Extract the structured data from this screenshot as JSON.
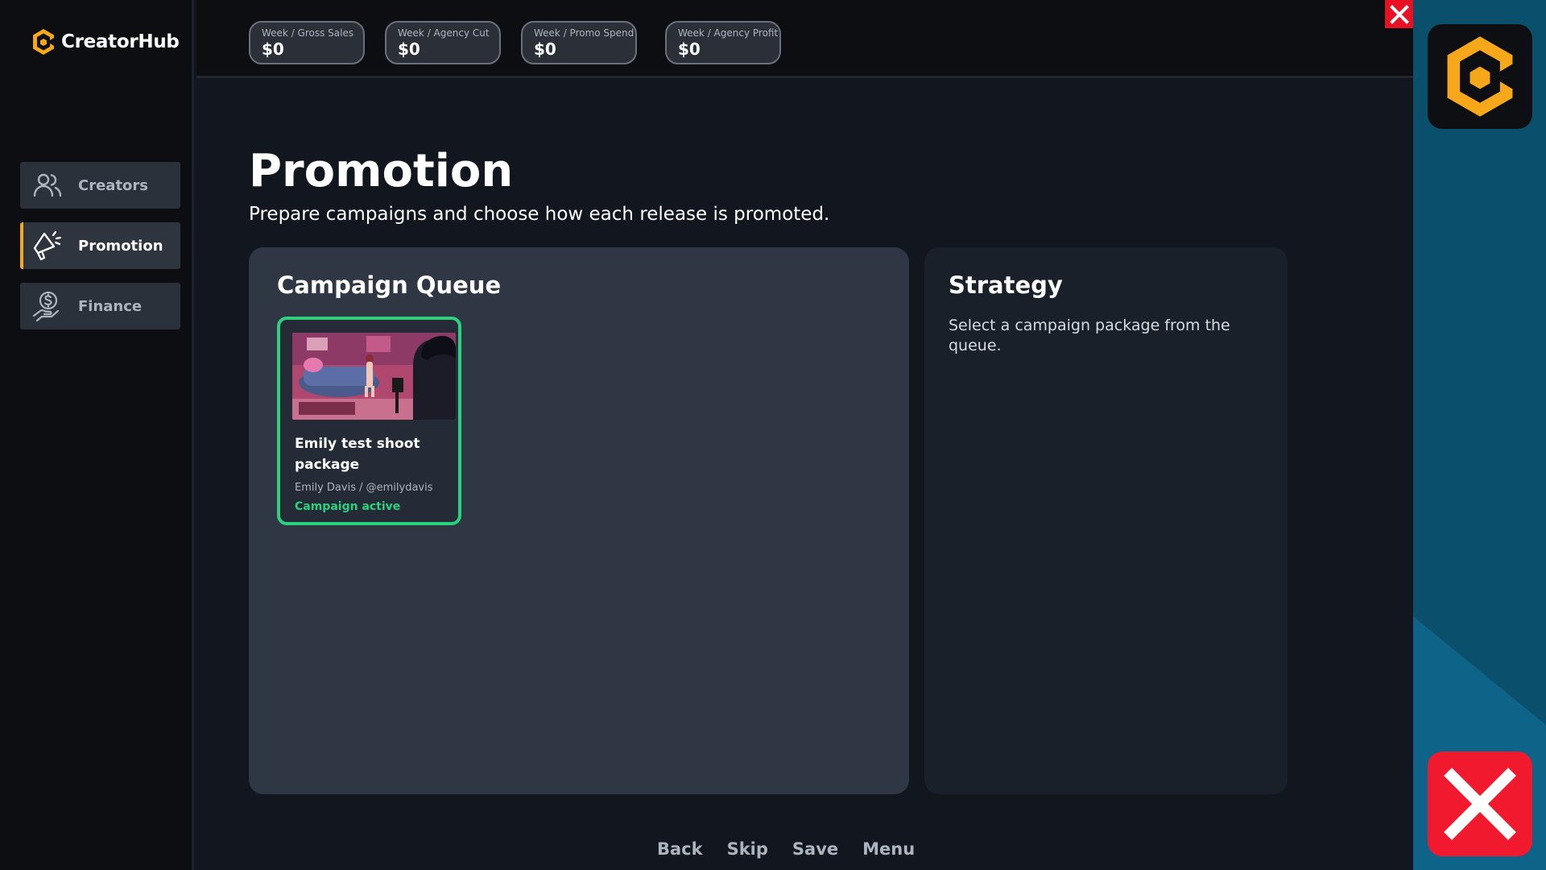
{
  "app": {
    "name": "CreatorHub"
  },
  "sidebar": {
    "items": [
      {
        "label": "Creators",
        "icon": "users-icon",
        "active": false
      },
      {
        "label": "Promotion",
        "icon": "megaphone-icon",
        "active": true
      },
      {
        "label": "Finance",
        "icon": "money-hand-icon",
        "active": false
      }
    ]
  },
  "stats": [
    {
      "label": "Week / Gross Sales",
      "value": "$0"
    },
    {
      "label": "Week / Agency Cut",
      "value": "$0"
    },
    {
      "label": "Week / Promo Spend",
      "value": "$0"
    },
    {
      "label": "Week / Agency Profit",
      "value": "$0"
    }
  ],
  "page": {
    "title": "Promotion",
    "subtitle": "Prepare campaigns and choose how each release is promoted."
  },
  "queue": {
    "title": "Campaign Queue",
    "cards": [
      {
        "title": "Emily test shoot package",
        "creator": "Emily Davis / @emilydavis",
        "status": "Campaign active"
      }
    ]
  },
  "strategy": {
    "title": "Strategy",
    "text": "Select a campaign package from the queue."
  },
  "footer": {
    "back": "Back",
    "skip": "Skip",
    "save": "Save",
    "menu": "Menu"
  },
  "window": {
    "close_glyph": "X"
  },
  "colors": {
    "accent": "#f6a81a",
    "active_green": "#2ad17e",
    "close_red": "#f0192d",
    "rail_blue": "#0a4f6c"
  }
}
